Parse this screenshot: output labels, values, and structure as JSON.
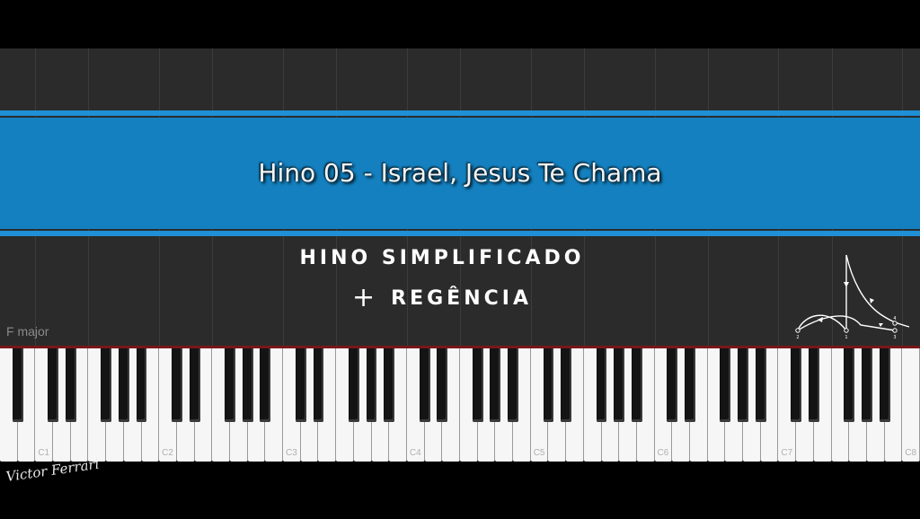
{
  "video": {
    "title": "Hino 05 - Israel, Jesus Te Chama",
    "subtitle_line1": "HINO SIMPLIFICADO",
    "subtitle_plus": "+",
    "subtitle_line2": "REGÊNCIA",
    "key_signature": "F major",
    "signature": "Victor Ferrari"
  },
  "conducting_diagram": {
    "icon": "conducting-pattern-icon",
    "beats": [
      "2",
      "1",
      "3",
      "4"
    ]
  },
  "keyboard": {
    "octave_labels": [
      "C1",
      "C2",
      "C3",
      "C4",
      "C5",
      "C6",
      "C7",
      "C8"
    ]
  },
  "colors": {
    "banner": "#1480bf",
    "banner_lines": "#1f8fd6",
    "background": "#2b2b2b",
    "divider": "#7a1717"
  }
}
